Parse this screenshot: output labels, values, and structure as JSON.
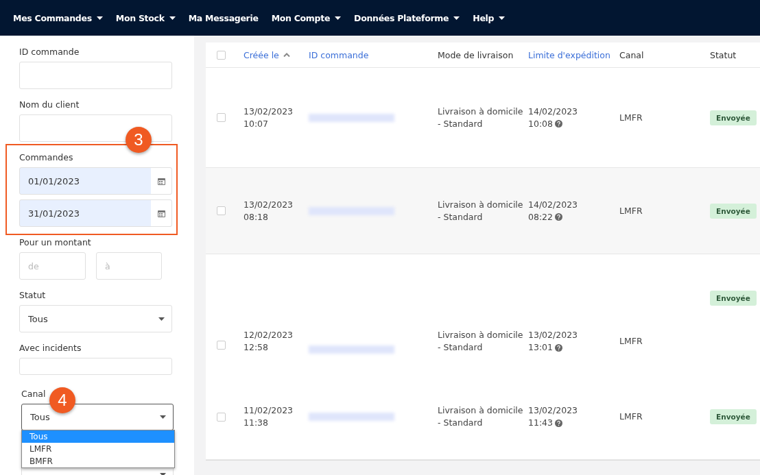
{
  "nav": [
    {
      "label": "Mes Commandes",
      "has_dropdown": true
    },
    {
      "label": "Mon Stock",
      "has_dropdown": true
    },
    {
      "label": "Ma Messagerie",
      "has_dropdown": false
    },
    {
      "label": "Mon Compte",
      "has_dropdown": true
    },
    {
      "label": "Données Plateforme",
      "has_dropdown": true
    },
    {
      "label": "Help",
      "has_dropdown": true
    }
  ],
  "filters": {
    "order_id": {
      "label": "ID commande"
    },
    "client_name": {
      "label": "Nom du client"
    },
    "orders_dates": {
      "label": "Commandes",
      "from": "01/01/2023",
      "to": "31/01/2023",
      "annotation": "3"
    },
    "amount": {
      "label": "Pour un montant",
      "min_placeholder": "de",
      "max_placeholder": "à"
    },
    "status": {
      "label": "Statut",
      "value": "Tous"
    },
    "incidents": {
      "label": "Avec incidents"
    },
    "channel": {
      "label": "Canal",
      "value": "Tous",
      "annotation": "4",
      "expanded": true,
      "options": [
        {
          "label": "Tous",
          "selected": true
        },
        {
          "label": "LMFR",
          "selected": false
        },
        {
          "label": "BMFR",
          "selected": false
        }
      ]
    }
  },
  "table": {
    "select_all_checked": false,
    "columns": [
      {
        "label": "Créée le",
        "sortable": true,
        "sorted": true
      },
      {
        "label": "ID commande",
        "sortable": true,
        "sorted": false
      },
      {
        "label": "Mode de livraison",
        "sortable": false,
        "sorted": false
      },
      {
        "label": "Limite d'expédition",
        "sortable": true,
        "sorted": false
      },
      {
        "label": "Canal",
        "sortable": false,
        "sorted": false
      },
      {
        "label": "Statut",
        "sortable": false,
        "sorted": false
      }
    ],
    "rows": [
      {
        "created_date": "13/02/2023",
        "created_time": "10:07",
        "delivery": [
          "Livraison à domicile",
          "- Standard"
        ],
        "limit_date": "14/02/2023",
        "limit_time": "10:08",
        "channel": "LMFR",
        "status": "Envoyée",
        "checked": false
      },
      {
        "created_date": "13/02/2023",
        "created_time": "08:18",
        "delivery": [
          "Livraison à domicile",
          "- Standard"
        ],
        "limit_date": "14/02/2023",
        "limit_time": "08:22",
        "channel": "LMFR",
        "status": "Envoyée",
        "checked": false
      },
      {
        "created_date": "12/02/2023",
        "created_time": "12:58",
        "delivery": [
          "Livraison à domicile",
          "- Standard"
        ],
        "limit_date": "13/02/2023",
        "limit_time": "13:01",
        "channel": "LMFR",
        "status": "Envoyée",
        "checked": false
      },
      {
        "created_date": "11/02/2023",
        "created_time": "11:38",
        "delivery": [
          "Livraison à domicile",
          "- Standard"
        ],
        "limit_date": "13/02/2023",
        "limit_time": "11:43",
        "channel": "LMFR",
        "status": "Envoyée",
        "checked": false
      }
    ]
  }
}
